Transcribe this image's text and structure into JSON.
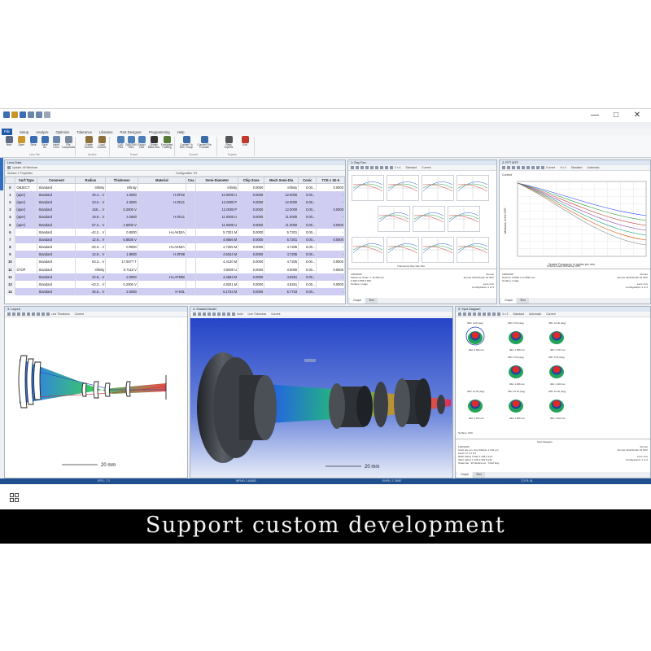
{
  "menubar": [
    "File",
    "Setup",
    "Analyze",
    "Optimize",
    "Tolerance",
    "Libraries",
    "Part Designer",
    "Programming",
    "Help"
  ],
  "ribbon": {
    "buttons": [
      {
        "label": "New",
        "color": "#5c6b80"
      },
      {
        "label": "Open",
        "color": "#c9962a"
      },
      {
        "label": "Save",
        "color": "#3b6db3"
      },
      {
        "label": "Save\nAs",
        "color": "#3b6db3"
      },
      {
        "label": "Insert\nLens",
        "color": "#6b86a8"
      },
      {
        "label": "File\nComparator",
        "color": "#7a8a9c"
      },
      {
        "label": "Create\nArchive",
        "color": "#8e6f3c"
      },
      {
        "label": "Load\nArchive",
        "color": "#8e6f3c"
      },
      {
        "label": "CAD\nFiles",
        "color": "#4c7fb8"
      },
      {
        "label": "ZAR/ZMX\nFiles",
        "color": "#4c7fb8"
      },
      {
        "label": "Export\nCAD",
        "color": "#4c7fb8"
      },
      {
        "label": "Zemax\nBlack Box",
        "color": "#333333"
      },
      {
        "label": "Encrypted\nCoating",
        "color": "#5a7a3a"
      },
      {
        "label": "Convert To\nNSC Group",
        "color": "#3a6aa8"
      },
      {
        "label": "Convert File\nFormats",
        "color": "#3a6aa8"
      },
      {
        "label": "Rays\nExperts",
        "color": "#555555"
      },
      {
        "label": "Exit",
        "color": "#c0392b"
      }
    ],
    "groups": [
      "Lens File",
      "Archive",
      "Export",
      "Convert",
      "Experts"
    ]
  },
  "lens_data": {
    "title": "Lens Data",
    "toolbar": "Update: All Windows",
    "subheader": "Surface 1 Properties",
    "config": "Configuration 1/3",
    "columns": [
      "",
      "Surf:Type",
      "Comment",
      "Radius",
      "Thickness",
      "Material",
      "Coa",
      "Semi-Diameter",
      "Chip Zone",
      "Mech Semi-Dia",
      "Conic",
      "TCE x 1E-6"
    ],
    "rows": [
      [
        "0",
        "OBJECT",
        "Standard",
        "Infinity",
        "Infinity",
        "",
        "",
        "Infinity",
        "0.0000",
        "Infinity",
        "0.00...",
        "0.0000"
      ],
      [
        "1",
        "(aper)",
        "Standard",
        "49.4... V",
        "1.0000",
        "H-ZF52",
        "",
        "12.0000 U",
        "0.0000",
        "12.0000",
        "0.00...",
        "-"
      ],
      [
        "2",
        "(aper)",
        "Standard",
        "23.0... V",
        "4.0000",
        "H-ZK11",
        "",
        "12.0000 P",
        "0.0000",
        "12.0000",
        "0.00...",
        "-"
      ],
      [
        "3",
        "(aper)",
        "Standard",
        "158.... V",
        "0.2000 V",
        "",
        "",
        "12.0000 P",
        "0.0000",
        "12.0000",
        "0.00...",
        "0.0000"
      ],
      [
        "4",
        "(aper)",
        "Standard",
        "19.9... V",
        "3.2500",
        "H-ZK11",
        "",
        "11.0000 U",
        "0.0000",
        "11.0000",
        "0.00...",
        "-"
      ],
      [
        "5",
        "(aper)",
        "Standard",
        "57.2... V",
        "1.5000 V",
        "",
        "",
        "11.0000 U",
        "0.0000",
        "11.0000",
        "0.00...",
        "0.0000"
      ],
      [
        "6",
        "",
        "Standard",
        "-42.2... V",
        "0.8000",
        "H-LAK53A",
        "",
        "5.7201 M",
        "0.0000",
        "5.7201",
        "0.00...",
        "-"
      ],
      [
        "7",
        "",
        "Standard",
        "12.9... V",
        "5.8835 V",
        "",
        "",
        "4.8566 M",
        "0.0000",
        "5.7201",
        "0.00...",
        "0.0000"
      ],
      [
        "8",
        "",
        "Standard",
        "-20.3... V",
        "0.9000",
        "H-LAK53A",
        "",
        "4.7205 M",
        "0.0000",
        "4.7205",
        "0.00...",
        "-"
      ],
      [
        "9",
        "",
        "Standard",
        "12.9... V",
        "1.8000",
        "H-ZF88",
        "",
        "4.5344 M",
        "0.0000",
        "4.7205",
        "0.00...",
        "-"
      ],
      [
        "10",
        "",
        "Standard",
        "63.3... V",
        "17.9077 T",
        "",
        "",
        "4.4120 M",
        "0.0000",
        "4.7205",
        "0.00...",
        "0.0000"
      ],
      [
        "11",
        "STOP",
        "Standard",
        "Infinity",
        "0.7118 V",
        "",
        "",
        "3.5000 U",
        "0.0000",
        "3.5000",
        "0.00...",
        "0.0000"
      ],
      [
        "12",
        "",
        "Standard",
        "22.8... V",
        "2.0000",
        "H-LAF50B",
        "",
        "4.4683 M",
        "0.0000",
        "4.8251",
        "0.00...",
        "-"
      ],
      [
        "13",
        "",
        "Standard",
        "-43.3... V",
        "0.2000 V",
        "",
        "",
        "4.8251 M",
        "0.0000",
        "4.8251",
        "0.00...",
        "0.0000"
      ],
      [
        "14",
        "",
        "Standard",
        "36.5... V",
        "2.0000",
        "H-K9L",
        "",
        "5.1734 M",
        "0.0000",
        "5.7718",
        "0.00...",
        "-"
      ]
    ]
  },
  "ray_fan": {
    "title": "1: Ray Fan",
    "toolbar_items": [
      "3 x 4",
      "Standard",
      "Current"
    ],
    "footer_title": "Transverse Ray Fan Plot",
    "footer_left": [
      "10/6/2020",
      "Maximum Scale: ± 10.000 µm",
      "0.486   0.588   0.656",
      "Surface: Image"
    ],
    "footer_right": [
      "Zemax",
      "Zemax OpticStudio 16 SP2",
      "",
      "Lens.zmx",
      "Configuration 1 of 3"
    ],
    "tabs": [
      "Graph",
      "Text"
    ]
  },
  "mtf": {
    "title": "2: FFT MTF",
    "toolbar_items": [
      "Current",
      "4 x 4",
      "Standard",
      "Automatic"
    ],
    "subtitle": "Current",
    "xlabel": "Spatial Frequency in cycles per mm",
    "ylabel": "Modulus of the OTF",
    "footer_title": "Polychromatic Diffraction MTF",
    "footer_left": [
      "10/6/2020",
      "Data for 0.4861 to 0.6563 µm.",
      "Surface: Image"
    ],
    "footer_right": [
      "Zemax",
      "Zemax OpticStudio 16 SP2",
      "",
      "Lens.zmx",
      "Configuration 1 of 3"
    ],
    "tabs": [
      "Graph",
      "Text"
    ]
  },
  "layout": {
    "title": "3: Layout",
    "toolbar_items": [
      "Line Thickness",
      "Current"
    ],
    "scale_label": "20 mm"
  },
  "shaded": {
    "title": "4: Shaded Model",
    "toolbar_items": [
      "Solid",
      "Line Thickness",
      "Current"
    ],
    "scale_label": "20 mm"
  },
  "spot": {
    "title": "5: Spot Diagram",
    "toolbar_items": [
      "3 x 3",
      "Standard",
      "Automatic",
      "Current"
    ],
    "fields": [
      {
        "label": "OBJ: 0.00 (deg)",
        "value": "IMA: 0.000 mm"
      },
      {
        "label": "OBJ: 5.00 (deg)",
        "value": "IMA: 1.389 mm"
      },
      {
        "label": "OBJ: 10.00 (deg)",
        "value": "IMA: 2.797 mm"
      },
      {
        "label": "OBJ: 5.00 (deg)",
        "value": "IMA: 1.389 mm"
      },
      {
        "label": "OBJ: 5.00 (deg)",
        "value": "IMA: 1.404 mm"
      },
      {
        "label": "OBJ: 10.00 (deg)",
        "value": "IMA: 2.784 mm"
      },
      {
        "label": "OBJ: 10.00 (deg)",
        "value": "IMA: 2.808 mm"
      },
      {
        "label": "OBJ: 10.00 (deg)",
        "value": "IMA: 2.813 mm"
      }
    ],
    "surface_label": "Surface: IMA",
    "footer_title": "Spot Diagram",
    "footer_left": [
      "10/6/2020",
      "Units are µm.   Airy Radius: 2.441 µm",
      "Field   1   2   3   4   5   6",
      "RMS radius   0.593   1.208   2.113",
      "GEO radius   1.215   2.932   5.211",
      "Scale bar : 20   Reference : Chief Ray"
    ],
    "footer_right": [
      "Zemax",
      "Zemax OpticStudio 16 SP2",
      "",
      "Lens.zmx",
      "Configuration 1 of 3"
    ],
    "tabs": [
      "Graph",
      "Text"
    ]
  },
  "statusbar": [
    "EFFL: 7.2",
    "WFNO: 2.60653",
    "ENPD: 2.75987",
    "TOTR: 61"
  ],
  "banner": "Support custom development",
  "colors": {
    "accent": "#1e5aa8",
    "highlight_row": "#cfcdf1",
    "shaded_bg": "#3f62d6"
  }
}
